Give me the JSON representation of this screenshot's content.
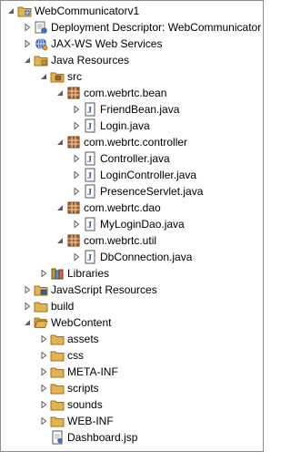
{
  "tree": [
    {
      "label": "WebCommunicatorv1",
      "icon": "project-icon",
      "depth": 0,
      "toggle": "expanded"
    },
    {
      "label": "Deployment Descriptor: WebCommunicator",
      "icon": "deployment-descriptor-icon",
      "depth": 1,
      "toggle": "collapsed"
    },
    {
      "label": "JAX-WS Web Services",
      "icon": "web-services-icon",
      "depth": 1,
      "toggle": "collapsed"
    },
    {
      "label": "Java Resources",
      "icon": "java-resources-icon",
      "depth": 1,
      "toggle": "expanded"
    },
    {
      "label": "src",
      "icon": "source-folder-icon",
      "depth": 2,
      "toggle": "expanded"
    },
    {
      "label": "com.webrtc.bean",
      "icon": "package-icon",
      "depth": 3,
      "toggle": "expanded"
    },
    {
      "label": "FriendBean.java",
      "icon": "java-file-icon",
      "depth": 4,
      "toggle": "collapsed"
    },
    {
      "label": "Login.java",
      "icon": "java-file-icon",
      "depth": 4,
      "toggle": "collapsed"
    },
    {
      "label": "com.webrtc.controller",
      "icon": "package-icon",
      "depth": 3,
      "toggle": "expanded"
    },
    {
      "label": "Controller.java",
      "icon": "java-file-icon",
      "depth": 4,
      "toggle": "collapsed"
    },
    {
      "label": "LoginController.java",
      "icon": "java-file-icon",
      "depth": 4,
      "toggle": "collapsed"
    },
    {
      "label": "PresenceServlet.java",
      "icon": "java-file-icon",
      "depth": 4,
      "toggle": "collapsed"
    },
    {
      "label": "com.webrtc.dao",
      "icon": "package-icon",
      "depth": 3,
      "toggle": "expanded"
    },
    {
      "label": "MyLoginDao.java",
      "icon": "java-file-icon",
      "depth": 4,
      "toggle": "collapsed"
    },
    {
      "label": "com.webrtc.util",
      "icon": "package-icon",
      "depth": 3,
      "toggle": "expanded"
    },
    {
      "label": "DbConnection.java",
      "icon": "java-file-icon",
      "depth": 4,
      "toggle": "collapsed"
    },
    {
      "label": "Libraries",
      "icon": "libraries-icon",
      "depth": 2,
      "toggle": "collapsed"
    },
    {
      "label": "JavaScript Resources",
      "icon": "javascript-resources-icon",
      "depth": 1,
      "toggle": "collapsed"
    },
    {
      "label": "build",
      "icon": "folder-icon",
      "depth": 1,
      "toggle": "collapsed"
    },
    {
      "label": "WebContent",
      "icon": "open-folder-icon",
      "depth": 1,
      "toggle": "expanded"
    },
    {
      "label": "assets",
      "icon": "folder-icon",
      "depth": 2,
      "toggle": "collapsed"
    },
    {
      "label": "css",
      "icon": "folder-icon",
      "depth": 2,
      "toggle": "collapsed"
    },
    {
      "label": "META-INF",
      "icon": "folder-icon",
      "depth": 2,
      "toggle": "collapsed"
    },
    {
      "label": "scripts",
      "icon": "folder-icon",
      "depth": 2,
      "toggle": "collapsed"
    },
    {
      "label": "sounds",
      "icon": "folder-icon",
      "depth": 2,
      "toggle": "collapsed"
    },
    {
      "label": "WEB-INF",
      "icon": "folder-icon",
      "depth": 2,
      "toggle": "collapsed"
    },
    {
      "label": "Dashboard.jsp",
      "icon": "jsp-file-icon",
      "depth": 2,
      "toggle": "none"
    }
  ],
  "colors": {
    "package": "#a9622c",
    "folder": "#e6b24f",
    "java_file": "#2a5ba6",
    "jar": "#c79a2c",
    "globe": "#3d6fb6",
    "toggle": "#5f5f5f"
  }
}
